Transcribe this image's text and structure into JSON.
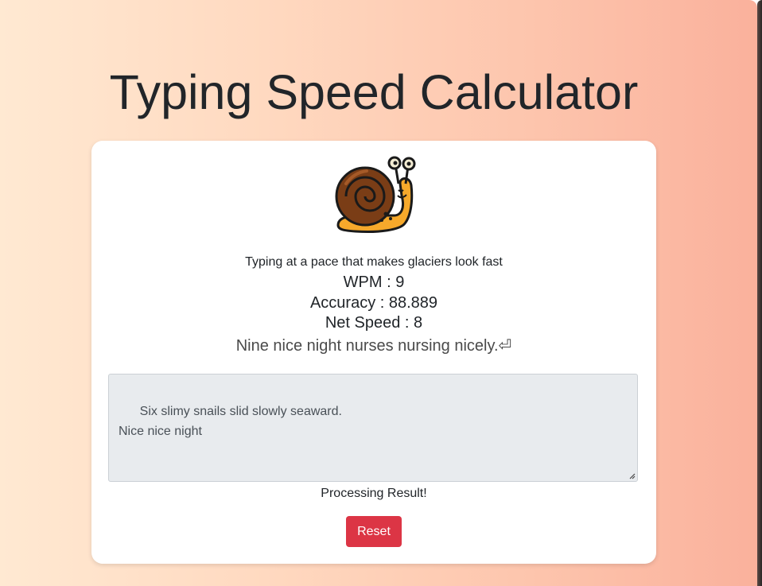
{
  "page": {
    "title": "Typing Speed Calculator"
  },
  "result": {
    "icon": "snail-icon",
    "message": "Typing at a pace that makes glaciers look fast",
    "wpm_text": "WPM : 9",
    "wpm": 9,
    "accuracy_text": "Accuracy : 88.889",
    "accuracy": 88.889,
    "net_speed_text": "Net Speed : 8",
    "net_speed": 8
  },
  "prompt": {
    "sentence": "Nine nice night nurses nursing nicely.⏎"
  },
  "input": {
    "value": "Six slimy snails slid slowly seaward.\nNice nice night"
  },
  "status": {
    "text": "Processing Result!"
  },
  "actions": {
    "reset_label": "Reset"
  },
  "colors": {
    "background_gradient_start": "#ffe9d2",
    "background_gradient_end": "#fab19c",
    "reset_button": "#dc3545",
    "textarea_background": "#e8ebee"
  }
}
